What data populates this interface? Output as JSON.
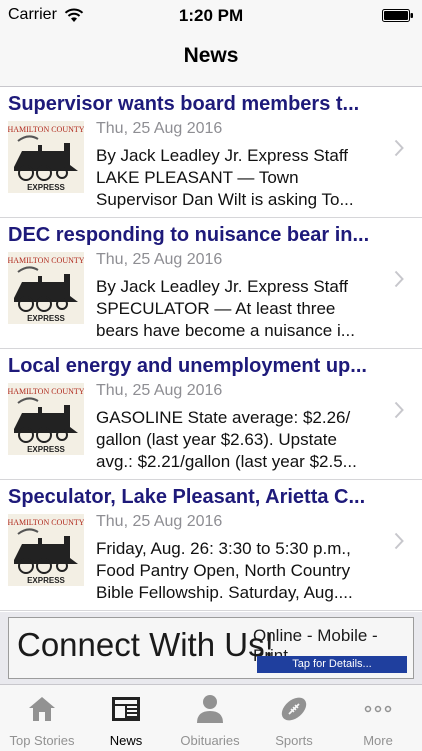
{
  "status": {
    "carrier": "Carrier",
    "time": "1:20 PM"
  },
  "nav": {
    "title": "News"
  },
  "articles": [
    {
      "title": "Supervisor wants board members t...",
      "date": "Thu, 25 Aug 2016",
      "excerpt_lines": [
        "By Jack Leadley Jr. Express Staff",
        "LAKE PLEASANT — Town",
        "Supervisor Dan Wilt is asking To..."
      ]
    },
    {
      "title": "DEC responding to nuisance bear in...",
      "date": "Thu, 25 Aug 2016",
      "excerpt_lines": [
        "By Jack Leadley Jr. Express Staff",
        "SPECULATOR — At least three",
        "bears have become a nuisance i..."
      ]
    },
    {
      "title": "Local energy and unemployment up...",
      "date": "Thu, 25 Aug 2016",
      "excerpt_lines": [
        "GASOLINE State average: $2.26/",
        "gallon (last year $2.63). Upstate",
        "avg.: $2.21/gallon (last year $2.5..."
      ]
    },
    {
      "title": "Speculator, Lake Pleasant, Arietta C...",
      "date": "Thu, 25 Aug 2016",
      "excerpt_lines": [
        "Friday, Aug. 26: 3:30 to 5:30 p.m.,",
        "Food Pantry Open, North Country",
        "Bible Fellowship. Saturday, Aug...."
      ]
    }
  ],
  "thumbnail": {
    "logo_top": "HAMILTON COUNTY",
    "logo_bottom": "EXPRESS"
  },
  "ad": {
    "headline": "Connect With Us!",
    "tagline": "Online - Mobile - Print",
    "button": "Tap for Details..."
  },
  "tabs": [
    {
      "label": "Top Stories",
      "icon": "house-icon",
      "active": false
    },
    {
      "label": "News",
      "icon": "newspaper-icon",
      "active": true
    },
    {
      "label": "Obituaries",
      "icon": "person-icon",
      "active": false
    },
    {
      "label": "Sports",
      "icon": "football-icon",
      "active": false
    },
    {
      "label": "More",
      "icon": "more-dots-icon",
      "active": false
    }
  ],
  "colors": {
    "headline": "#1e1a7a",
    "active_tab": "#000000",
    "inactive_tab": "#929292",
    "ad_button": "#1f3f9e"
  }
}
